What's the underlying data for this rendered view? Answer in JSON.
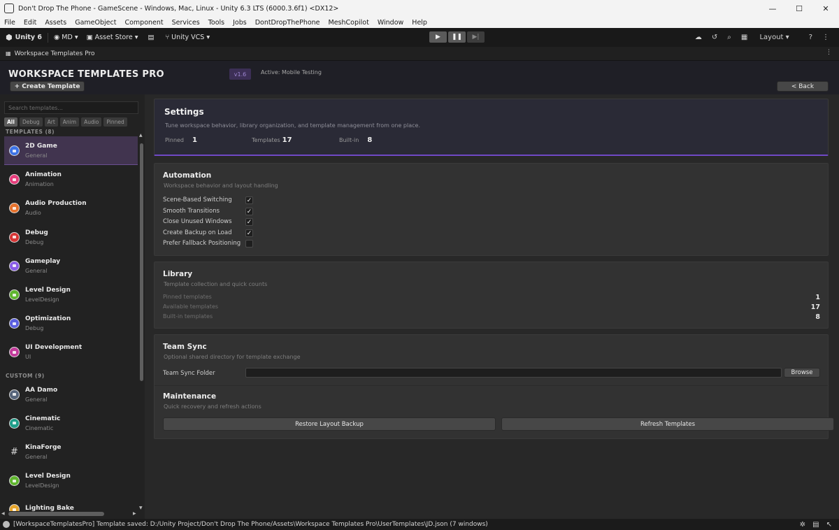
{
  "window": {
    "title": "Don't Drop The Phone - GameScene - Windows, Mac, Linux - Unity 6.3 LTS (6000.3.6f1) <DX12>",
    "controls": [
      "—",
      "☐",
      "✕"
    ]
  },
  "menu": [
    "File",
    "Edit",
    "Assets",
    "GameObject",
    "Component",
    "Services",
    "Tools",
    "Jobs",
    "DontDropThePhone",
    "MeshCopilot",
    "Window",
    "Help"
  ],
  "toolbar": {
    "unity_label": "Unity 6",
    "account_label": "MD ▾",
    "asset_store_label": "Asset Store ▾",
    "vcs_label": "Unity VCS ▾",
    "layout_label": "Layout ▾"
  },
  "tab": {
    "title": "Workspace Templates Pro"
  },
  "header": {
    "app_title": "WORKSPACE TEMPLATES PRO",
    "version": "v1.6",
    "active": "Active: Mobile Testing",
    "create_label": "+ Create Template",
    "back_label": "< Back"
  },
  "sidebar": {
    "search_placeholder": "Search templates...",
    "filters": [
      "All",
      "Debug",
      "Art",
      "Anim",
      "Audio",
      "Pinned"
    ],
    "active_filter": "All",
    "templates_heading": "TEMPLATES (8)",
    "custom_heading": "CUSTOM (9)",
    "templates": [
      {
        "name": "2D Game",
        "category": "General",
        "color": "#3d73e6",
        "selected": true
      },
      {
        "name": "Animation",
        "category": "Animation",
        "color": "#e63d7c"
      },
      {
        "name": "Audio Production",
        "category": "Audio",
        "color": "#e6722d"
      },
      {
        "name": "Debug",
        "category": "Debug",
        "color": "#d63535"
      },
      {
        "name": "Gameplay",
        "category": "General",
        "color": "#8a5de6"
      },
      {
        "name": "Level Design",
        "category": "LevelDesign",
        "color": "#5fb52e"
      },
      {
        "name": "Optimization",
        "category": "Debug",
        "color": "#5a5fe0"
      },
      {
        "name": "UI Development",
        "category": "UI",
        "color": "#c23a9a"
      }
    ],
    "custom": [
      {
        "name": "AA Damo",
        "category": "General",
        "color": "#56647a"
      },
      {
        "name": "Cinematic",
        "category": "Cinematic",
        "color": "#1f9e8a"
      },
      {
        "name": "KinaForge",
        "category": "General",
        "color": "grid"
      },
      {
        "name": "Level Design",
        "category": "LevelDesign",
        "color": "#5fb52e"
      },
      {
        "name": "Lighting Bake",
        "category": "",
        "color": "#e6a52d"
      }
    ]
  },
  "settings": {
    "title": "Settings",
    "description": "Tune workspace behavior, library organization, and template management from one place.",
    "stats": [
      {
        "label": "Pinned",
        "value": "1"
      },
      {
        "label": "Templates",
        "value": "17"
      },
      {
        "label": "Built-in",
        "value": "8"
      }
    ]
  },
  "automation": {
    "title": "Automation",
    "description": "Workspace behavior and layout handling",
    "options": [
      {
        "label": "Scene-Based Switching",
        "checked": true
      },
      {
        "label": "Smooth Transitions",
        "checked": true
      },
      {
        "label": "Close Unused Windows",
        "checked": true
      },
      {
        "label": "Create Backup on Load",
        "checked": true
      },
      {
        "label": "Prefer Fallback Positioning",
        "checked": false
      }
    ]
  },
  "library": {
    "title": "Library",
    "description": "Template collection and quick counts",
    "rows": [
      {
        "label": "Pinned templates",
        "value": "1"
      },
      {
        "label": "Available templates",
        "value": "17"
      },
      {
        "label": "Built-in templates",
        "value": "8"
      }
    ]
  },
  "team_sync": {
    "title": "Team Sync",
    "description": "Optional shared directory for template exchange",
    "folder_label": "Team Sync Folder",
    "folder_value": "",
    "browse_label": "Browse"
  },
  "maintenance": {
    "title": "Maintenance",
    "description": "Quick recovery and refresh actions",
    "restore_label": "Restore Layout Backup",
    "refresh_label": "Refresh Templates"
  },
  "status": {
    "message": "[WorkspaceTemplatesPro] Template saved: D:/Unity Project/Don't Drop The Phone/Assets\\Workspace Templates Pro\\UserTemplates\\JD.json (7 windows)"
  }
}
